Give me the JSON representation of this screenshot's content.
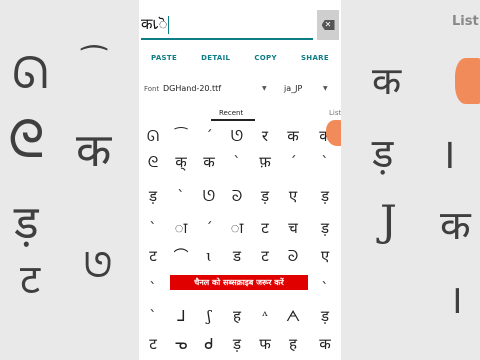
{
  "app": {
    "search": {
      "value": "क𑅵ॆ"
    },
    "actions": [
      "PASTE",
      "DETAIL",
      "COPY",
      "SHARE"
    ],
    "font": {
      "label": "Font",
      "name": "DGHand-20.ttf",
      "locale": "ja_JP"
    },
    "tabs": {
      "recent": "Recent",
      "list": "List"
    },
    "glyph_rows": [
      [
        "ᘏ",
        "⁀",
        "ˊ",
        "ᘎ",
        "र",
        "क",
        "क"
      ],
      [
        "ᘓ",
        "क्",
        "क",
        "ˋ",
        "फ़",
        "ˊ",
        "ˋ"
      ],
      [
        "ड़",
        "ˋ",
        "ᘎ",
        "ᘐ",
        "ड़",
        "ए",
        "ड़"
      ],
      [
        "ˋ",
        "ा",
        "ˊ",
        "ा",
        "ट",
        "च",
        "ड़"
      ],
      [
        "ट",
        "⌒",
        "ɩ",
        "ड",
        "ट",
        "ᘐ",
        "ए"
      ],
      [
        "ˋ",
        "",
        "",
        "",
        "",
        "",
        "ˋ"
      ],
      [
        "ˋ",
        "ᒧ",
        "ʃ",
        "ह",
        "ᶺ",
        "ᗅ",
        "ड़"
      ],
      [
        "ट",
        "ᓀ",
        "ᑯ",
        "ड़",
        "फ",
        "ह",
        "क"
      ]
    ],
    "banner": "चैनल को सब्सक्राइब जरूर करें"
  },
  "background": {
    "list_label": "List",
    "glyphs": [
      "ᘏ",
      "⁀",
      "क",
      "ᘓ",
      "क",
      "ड़",
      "।",
      "ड़",
      "J",
      "ट",
      "ᘎ",
      "क",
      "।"
    ]
  }
}
